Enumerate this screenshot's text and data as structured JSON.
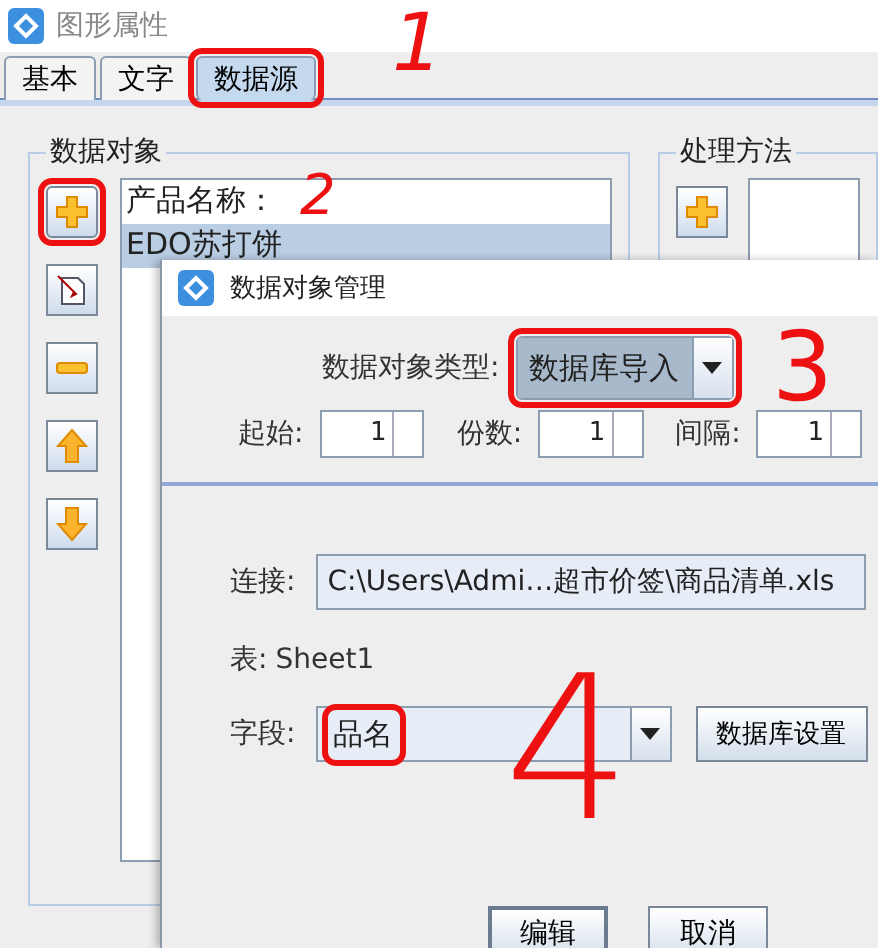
{
  "window": {
    "title": "图形属性"
  },
  "tabs": [
    {
      "label": "基本",
      "selected": false,
      "highlighted": false
    },
    {
      "label": "文字",
      "selected": false,
      "highlighted": false
    },
    {
      "label": "数据源",
      "selected": true,
      "highlighted": true
    }
  ],
  "data_objects": {
    "title": "数据对象",
    "buttons": [
      {
        "kind": "add",
        "highlighted": true
      },
      {
        "kind": "edit",
        "highlighted": false
      },
      {
        "kind": "remove",
        "highlighted": false
      },
      {
        "kind": "up",
        "highlighted": false
      },
      {
        "kind": "down",
        "highlighted": false
      }
    ],
    "items": [
      {
        "label": "产品名称：",
        "selected": false
      },
      {
        "label": "EDO苏打饼",
        "selected": true
      }
    ]
  },
  "processing": {
    "title": "处理方法",
    "buttons": [
      {
        "kind": "add",
        "highlighted": false
      }
    ]
  },
  "dialog": {
    "title": "数据对象管理",
    "type_label": "数据对象类型:",
    "type_value": "数据库导入",
    "type_highlighted": true,
    "spinners": [
      {
        "label": "起始:",
        "value": "1"
      },
      {
        "label": "份数:",
        "value": "1"
      },
      {
        "label": "间隔:",
        "value": "1"
      }
    ],
    "connection_label": "连接:",
    "connection_value": "C:\\Users\\Admi…超市价签\\商品清单.xls",
    "table_label": "表:",
    "table_value": "Sheet1",
    "field_label": "字段:",
    "field_value": "品名",
    "field_highlighted": true,
    "db_settings_button": "数据库设置",
    "buttons": [
      "编辑",
      "取消"
    ]
  },
  "annotations": [
    {
      "text": "1"
    },
    {
      "text": "2"
    },
    {
      "text": "3"
    },
    {
      "text": "4"
    }
  ]
}
